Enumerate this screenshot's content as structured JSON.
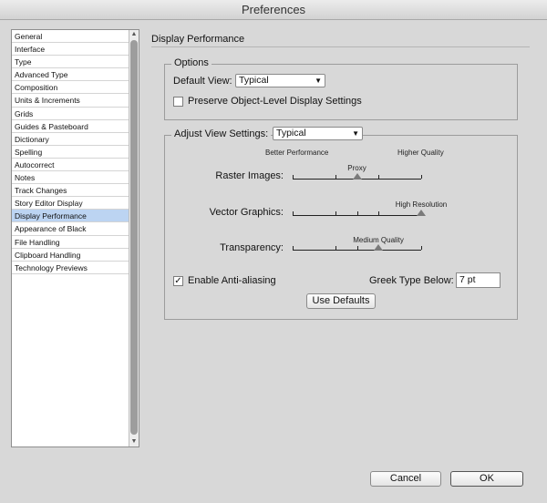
{
  "window": {
    "title": "Preferences"
  },
  "sidebar": {
    "items": [
      {
        "label": "General"
      },
      {
        "label": "Interface"
      },
      {
        "label": "Type"
      },
      {
        "label": "Advanced Type"
      },
      {
        "label": "Composition"
      },
      {
        "label": "Units & Increments"
      },
      {
        "label": "Grids"
      },
      {
        "label": "Guides & Pasteboard"
      },
      {
        "label": "Dictionary"
      },
      {
        "label": "Spelling"
      },
      {
        "label": "Autocorrect"
      },
      {
        "label": "Notes"
      },
      {
        "label": "Track Changes"
      },
      {
        "label": "Story Editor Display"
      },
      {
        "label": "Display Performance"
      },
      {
        "label": "Appearance of Black"
      },
      {
        "label": "File Handling"
      },
      {
        "label": "Clipboard Handling"
      },
      {
        "label": "Technology Previews"
      }
    ],
    "selected_index": 14
  },
  "panel": {
    "title": "Display Performance",
    "options": {
      "group_label": "Options",
      "default_view_label": "Default View:",
      "default_view_value": "Typical",
      "preserve_label": "Preserve Object-Level Display Settings",
      "preserve_checked": false
    },
    "adjust": {
      "group_label": "Adjust View Settings:",
      "value": "Typical",
      "better_performance": "Better Performance",
      "higher_quality": "Higher Quality",
      "sliders": [
        {
          "label": "Raster Images:",
          "value_label": "Proxy",
          "position": 0.5
        },
        {
          "label": "Vector Graphics:",
          "value_label": "High Resolution",
          "position": 1.0
        },
        {
          "label": "Transparency:",
          "value_label": "Medium Quality",
          "position": 0.667
        }
      ],
      "antialias_label": "Enable Anti-aliasing",
      "antialias_checked": true,
      "greek_label": "Greek Type Below:",
      "greek_value": "7 pt",
      "use_defaults_label": "Use Defaults"
    }
  },
  "footer": {
    "cancel_label": "Cancel",
    "ok_label": "OK"
  },
  "icons": {
    "checkmark": "✓",
    "dropdown": "▼",
    "scroll_up": "▲",
    "scroll_down": "▼"
  }
}
